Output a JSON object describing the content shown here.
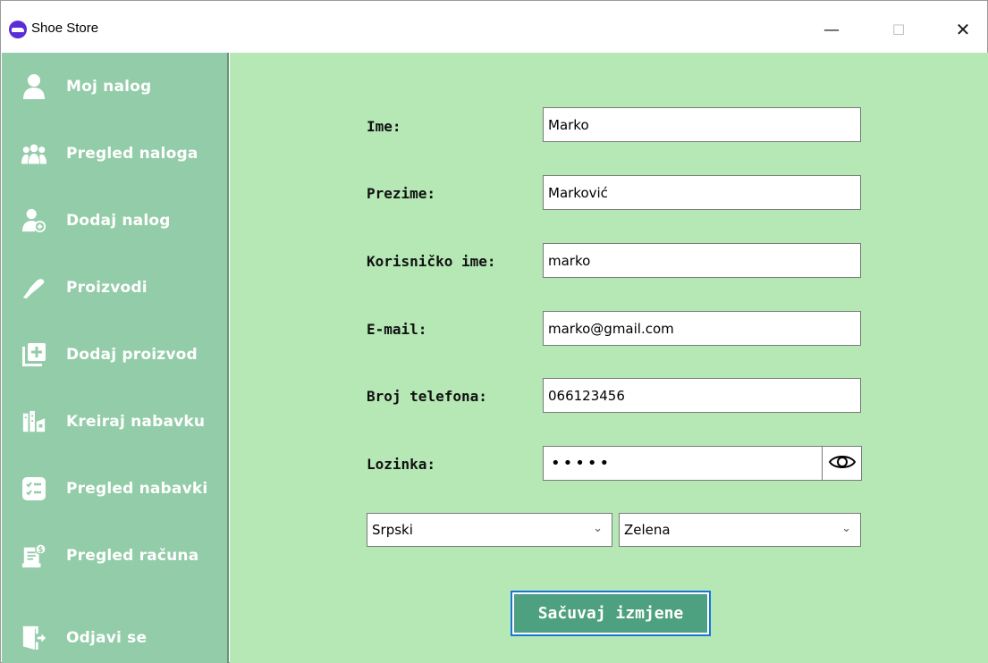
{
  "window": {
    "title": "Shoe Store",
    "minimize_glyph": "—",
    "maximize_glyph": "☐",
    "close_glyph": "✕"
  },
  "sidebar": {
    "items": [
      {
        "label": "Moj nalog",
        "icon": "user-icon"
      },
      {
        "label": "Pregled naloga",
        "icon": "users-group-icon"
      },
      {
        "label": "Dodaj nalog",
        "icon": "add-user-icon"
      },
      {
        "label": "Proizvodi",
        "icon": "shoe-icon"
      },
      {
        "label": "Dodaj proizvod",
        "icon": "add-box-icon"
      },
      {
        "label": "Kreiraj nabavku",
        "icon": "warehouse-icon"
      },
      {
        "label": "Pregled nabavki",
        "icon": "checklist-icon"
      },
      {
        "label": "Pregled računa",
        "icon": "receipt-icon"
      },
      {
        "label": "Odjavi se",
        "icon": "logout-icon"
      }
    ]
  },
  "form": {
    "first_name": {
      "label": "Ime:",
      "value": "Marko"
    },
    "last_name": {
      "label": "Prezime:",
      "value": "Marković"
    },
    "username": {
      "label": "Korisničko ime:",
      "value": "marko"
    },
    "email": {
      "label": "E-mail:",
      "value": "marko@gmail.com"
    },
    "phone": {
      "label": "Broj telefona:",
      "value": "066123456"
    },
    "password": {
      "label": "Lozinka:",
      "masked_value": "•••••"
    },
    "language": {
      "selected": "Srpski"
    },
    "theme": {
      "selected": "Zelena"
    },
    "save_label": "Sačuvaj izmjene"
  },
  "colors": {
    "sidebar_bg": "#93cca8",
    "main_bg": "#b5e8b5",
    "button_bg": "#4ea180",
    "button_focus_border": "#1677d6"
  }
}
